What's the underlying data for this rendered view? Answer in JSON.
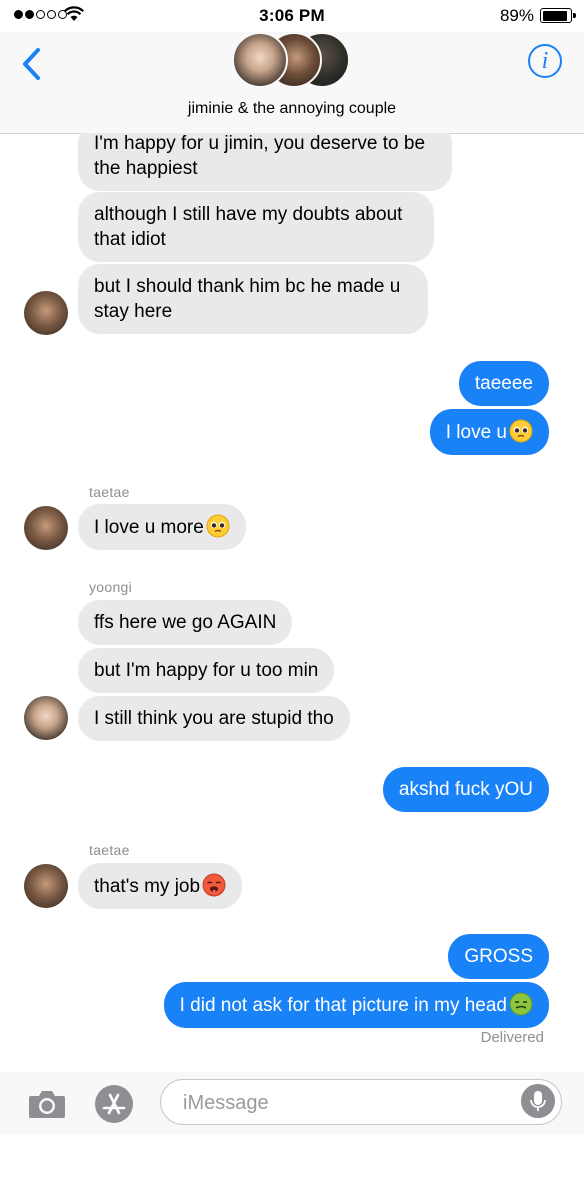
{
  "status_bar": {
    "time": "3:06 PM",
    "battery_percent": "89%",
    "battery_level": 0.89,
    "signal_bars": 2
  },
  "header": {
    "back_icon": "chevron-left-icon",
    "title": "jiminie & the annoying couple",
    "info_icon": "info-icon",
    "info_glyph": "i"
  },
  "messages": [
    {
      "direction": "incoming",
      "text": "I'm happy for u jimin, you deserve to be the happiest"
    },
    {
      "direction": "incoming",
      "text": "although I still have my doubts about that idiot"
    },
    {
      "direction": "incoming",
      "text": "but I should thank him bc he made u stay here"
    },
    {
      "direction": "outgoing",
      "text": "taeeee"
    },
    {
      "direction": "outgoing",
      "text": "I love u",
      "emoji": "pleading-face-emoji"
    },
    {
      "direction": "incoming",
      "sender": "taetae",
      "text": "I love u more",
      "emoji": "pleading-face-emoji"
    },
    {
      "direction": "incoming",
      "sender": "yoongi",
      "text": "ffs here we go AGAIN"
    },
    {
      "direction": "incoming",
      "text": "but I'm happy for u too min"
    },
    {
      "direction": "incoming",
      "text": "I still think you are stupid tho"
    },
    {
      "direction": "outgoing",
      "text": "akshd fuck yOU"
    },
    {
      "direction": "incoming",
      "sender": "taetae",
      "text": "that's my job",
      "emoji": "hot-face-emoji"
    },
    {
      "direction": "outgoing",
      "text": "GROSS"
    },
    {
      "direction": "outgoing",
      "text": "I did not ask for that picture in my head",
      "emoji": "nauseated-face-emoji"
    }
  ],
  "delivered_label": "Delivered",
  "input_bar": {
    "camera_icon": "camera-icon",
    "apps_icon": "app-store-icon",
    "placeholder": "iMessage",
    "mic_icon": "microphone-icon"
  },
  "colors": {
    "outgoing_bubble": "#1a82f7",
    "incoming_bubble": "#e9e9eb",
    "accent": "#1a82f7"
  }
}
